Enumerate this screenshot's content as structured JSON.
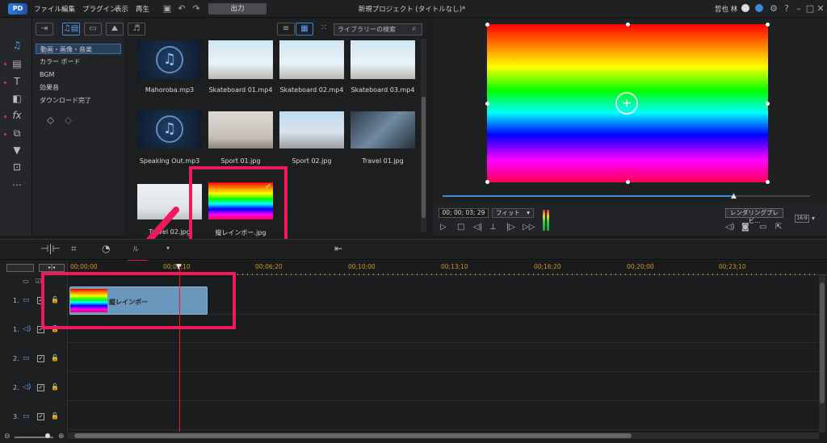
{
  "app": {
    "logo": "PD",
    "menu": [
      "ファイル",
      "編集",
      "プラグイン",
      "表示",
      "再生"
    ],
    "output_label": "出力",
    "title": "新規プロジェクト (タイトルなし)*",
    "user": "哲也 林",
    "window_controls": [
      "?",
      "–",
      "□",
      "✕"
    ]
  },
  "categories": [
    "動画・画像・音楽",
    "カラー ボード",
    "BGM",
    "効果音",
    "ダウンロード完了"
  ],
  "search": {
    "placeholder": "ライブラリーの検索"
  },
  "media_items": [
    {
      "name": "Mahoroba.mp3",
      "type": "audio"
    },
    {
      "name": "Skateboard 01.mp4",
      "type": "video"
    },
    {
      "name": "Skateboard 02.mp4",
      "type": "video"
    },
    {
      "name": "Skateboard 03.mp4",
      "type": "video"
    },
    {
      "name": "Speaking Out.mp3",
      "type": "audio"
    },
    {
      "name": "Sport 01.jpg",
      "type": "image"
    },
    {
      "name": "Sport 02.jpg",
      "type": "image"
    },
    {
      "name": "Travel 01.jpg",
      "type": "image"
    },
    {
      "name": "Travel 02.jpg",
      "type": "image"
    },
    {
      "name": "縦レインボー.jpg",
      "type": "image",
      "selected": true
    }
  ],
  "preview": {
    "timecode": "00; 00; 03; 29",
    "fit_label": "フィット",
    "render_label": "レンダリングプレビ...",
    "aspect": "16:9"
  },
  "timeline": {
    "ruler_ticks": [
      "00;00;00",
      "00;03;10",
      "00;06;20",
      "00;10;00",
      "00;13;10",
      "00;16;20",
      "00;20;00",
      "00;23;10"
    ],
    "tracks": [
      "1.",
      "1.",
      "2.",
      "2.",
      "3."
    ],
    "clip_label": "縦レインボー"
  },
  "colors": {
    "accent": "#3d8be0",
    "highlight": "#f0195a",
    "playhead": "#dd2233"
  }
}
